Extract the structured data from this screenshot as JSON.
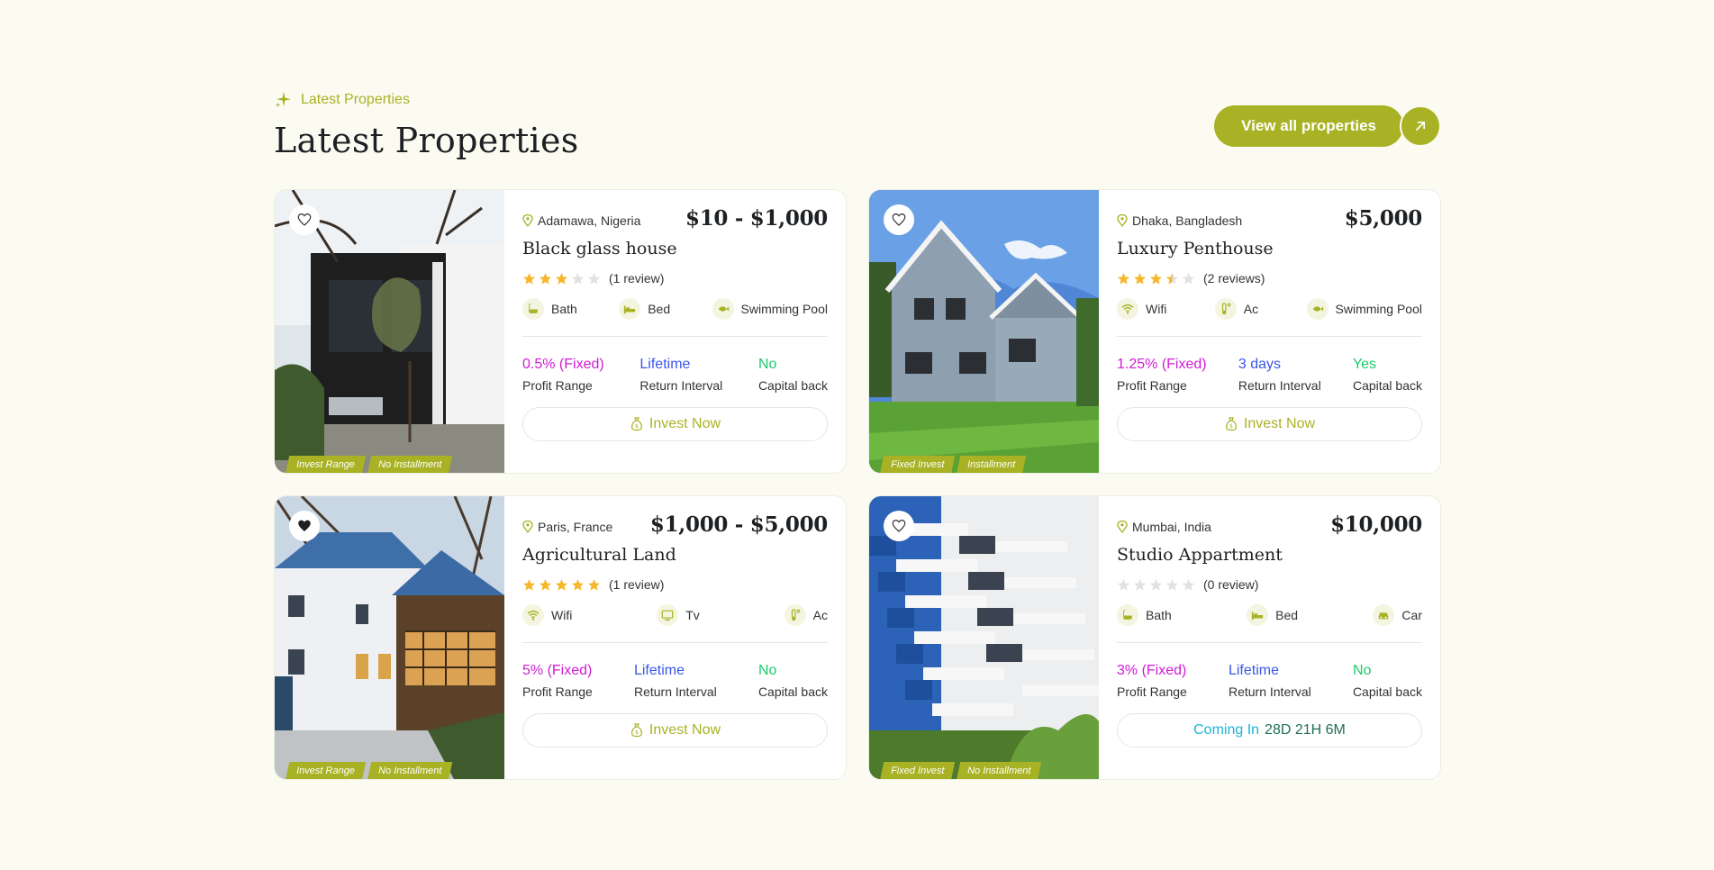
{
  "section": {
    "eyebrow": "Latest Properties",
    "title": "Latest Properties",
    "view_all_label": "View all properties"
  },
  "colors": {
    "accent": "#a8b224",
    "profit": "#d21bd6",
    "return": "#3a57e8",
    "capital": "#1ccb6b",
    "coming": "#17b4d8",
    "star": "#f5b72c"
  },
  "cards": [
    {
      "location": "Adamawa, Nigeria",
      "price": "$10 - $1,000",
      "name": "Black glass house",
      "rating": 3,
      "review_text": "(1 review)",
      "favorited": false,
      "amenities": [
        {
          "icon": "bath-icon",
          "label": "Bath"
        },
        {
          "icon": "bed-icon",
          "label": "Bed"
        },
        {
          "icon": "swimming-pool-icon",
          "label": "Swimming Pool"
        }
      ],
      "profit_value": "0.5% (Fixed)",
      "profit_label": "Profit Range",
      "return_value": "Lifetime",
      "return_label": "Return Interval",
      "capital_value": "No",
      "capital_label": "Capital back",
      "action": "Invest Now",
      "tags": [
        "Invest Range",
        "No Installment"
      ]
    },
    {
      "location": "Dhaka, Bangladesh",
      "price": "$5,000",
      "name": "Luxury Penthouse",
      "rating": 3.5,
      "review_text": "(2 reviews)",
      "favorited": false,
      "amenities": [
        {
          "icon": "wifi-icon",
          "label": "Wifi"
        },
        {
          "icon": "ac-icon",
          "label": "Ac"
        },
        {
          "icon": "swimming-pool-icon",
          "label": "Swimming Pool"
        }
      ],
      "profit_value": "1.25% (Fixed)",
      "profit_label": "Profit Range",
      "return_value": "3 days",
      "return_label": "Return Interval",
      "capital_value": "Yes",
      "capital_label": "Capital back",
      "action": "Invest Now",
      "tags": [
        "Fixed Invest",
        "Installment"
      ]
    },
    {
      "location": "Paris, France",
      "price": "$1,000 - $5,000",
      "name": "Agricultural Land",
      "rating": 5,
      "review_text": "(1 review)",
      "favorited": true,
      "amenities": [
        {
          "icon": "wifi-icon",
          "label": "Wifi"
        },
        {
          "icon": "tv-icon",
          "label": "Tv"
        },
        {
          "icon": "ac-icon",
          "label": "Ac"
        }
      ],
      "profit_value": "5% (Fixed)",
      "profit_label": "Profit Range",
      "return_value": "Lifetime",
      "return_label": "Return Interval",
      "capital_value": "No",
      "capital_label": "Capital back",
      "action": "Invest Now",
      "tags": [
        "Invest Range",
        "No Installment"
      ]
    },
    {
      "location": "Mumbai, India",
      "price": "$10,000",
      "name": "Studio Appartment",
      "rating": 0,
      "review_text": "(0 review)",
      "favorited": false,
      "amenities": [
        {
          "icon": "bath-icon",
          "label": "Bath"
        },
        {
          "icon": "bed-icon",
          "label": "Bed"
        },
        {
          "icon": "car-icon",
          "label": "Car"
        }
      ],
      "profit_value": "3% (Fixed)",
      "profit_label": "Profit Range",
      "return_value": "Lifetime",
      "return_label": "Return Interval",
      "capital_value": "No",
      "capital_label": "Capital back",
      "coming_label": "Coming In",
      "coming_time": "28D 21H 6M",
      "tags": [
        "Fixed Invest",
        "No Installment"
      ]
    }
  ]
}
